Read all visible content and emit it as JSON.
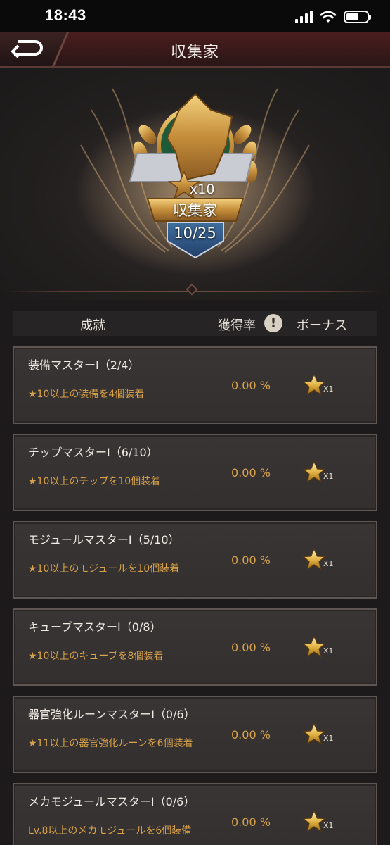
{
  "status": {
    "time": "18:43"
  },
  "header": {
    "title": "収集家"
  },
  "hero": {
    "star_multiplier": "x10",
    "badge_name": "収集家",
    "progress": "10/25"
  },
  "table": {
    "columns": [
      "成就",
      "獲得率",
      "ボーナス"
    ],
    "info_glyph": "!"
  },
  "achievements": [
    {
      "title": "装備マスターⅠ（2/4）",
      "desc": "★10以上の装備を4個装着",
      "rate": "0.00 %",
      "bonus": "X1"
    },
    {
      "title": "チップマスターⅠ（6/10）",
      "desc": "★10以上のチップを10個装着",
      "rate": "0.00 %",
      "bonus": "X1"
    },
    {
      "title": "モジュールマスターⅠ（5/10）",
      "desc": "★10以上のモジュールを10個装着",
      "rate": "0.00 %",
      "bonus": "X1"
    },
    {
      "title": "キューブマスターⅠ（0/8）",
      "desc": "★10以上のキューブを8個装着",
      "rate": "0.00 %",
      "bonus": "X1"
    },
    {
      "title": "器官強化ルーンマスターⅠ（0/6）",
      "desc": "★11以上の器官強化ルーンを6個装着",
      "rate": "0.00 %",
      "bonus": "X1"
    },
    {
      "title": "メカモジュールマスターⅠ（0/6）",
      "desc": "Lv.8以上のメカモジュールを6個装備",
      "rate": "0.00 %",
      "bonus": "X1"
    }
  ],
  "icons": {
    "back": "back-arrow-icon",
    "info": "info-icon",
    "star": "star-icon"
  },
  "colors": {
    "accent_gold": "#d8a24a",
    "header_red": "#4a1d1d"
  }
}
